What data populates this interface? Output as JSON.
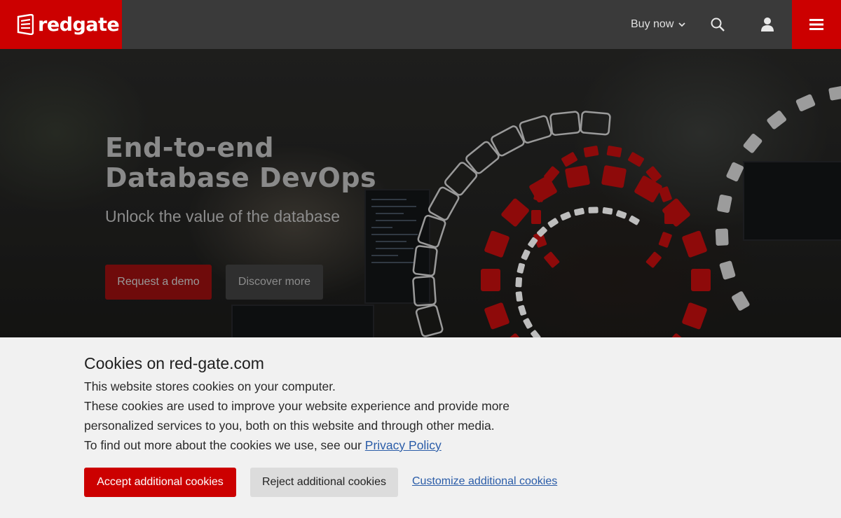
{
  "brand": {
    "name": "redgate",
    "color": "#cc0000"
  },
  "header": {
    "buy_now_label": "Buy now",
    "icons": [
      "chevron-down-icon",
      "search-icon",
      "user-icon",
      "menu-icon"
    ]
  },
  "hero": {
    "title": "End-to-end Database DevOps",
    "subtitle": "Unlock the value of the database",
    "primary_button": "Request a demo",
    "secondary_button": "Discover more"
  },
  "cookie_banner": {
    "title": "Cookies on red-gate.com",
    "line1": "This website stores cookies on your computer.",
    "line2": "These cookies are used to improve your website experience and provide more personalized services to you, both on this website and through other media.",
    "line3_prefix": "To find out more about the cookies we use, see our ",
    "privacy_link": "Privacy Policy",
    "accept_button": "Accept additional cookies",
    "reject_button": "Reject additional cookies",
    "customize_link": "Customize additional cookies"
  },
  "colors": {
    "accent": "#cc0000",
    "header_bg": "#3a3a3a",
    "banner_bg": "#f1f1f1",
    "link": "#2a5ca8"
  }
}
